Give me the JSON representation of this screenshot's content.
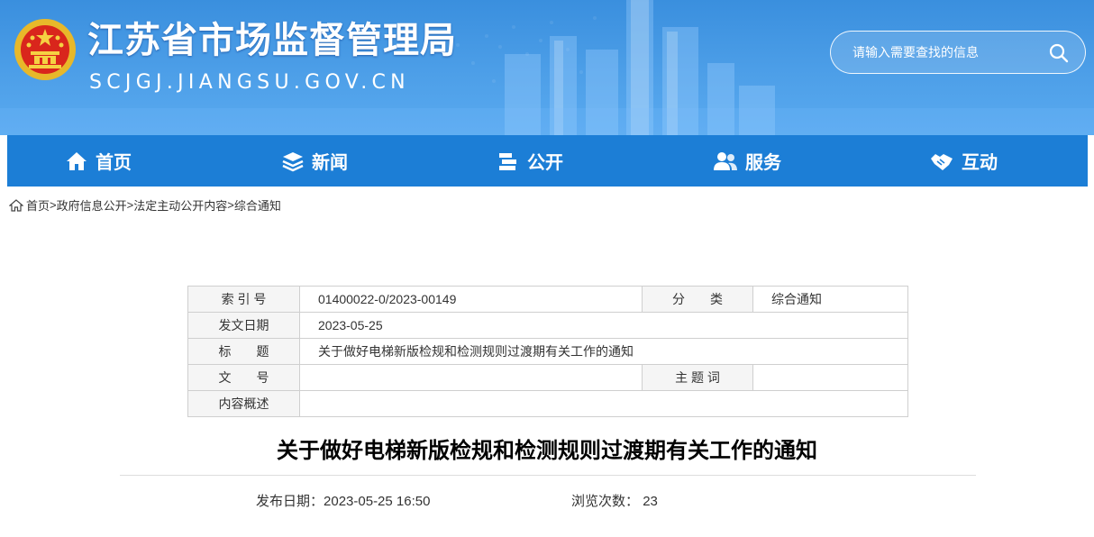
{
  "header": {
    "site_title": "江苏省市场监督管理局",
    "site_domain": "SCJGJ.JIANGSU.GOV.CN",
    "emblem_icon": "national-emblem-icon",
    "search_placeholder": "请输入需要查找的信息",
    "search_icon": "search-icon"
  },
  "nav": {
    "items": [
      {
        "label": "首页",
        "icon": "home-icon"
      },
      {
        "label": "新闻",
        "icon": "layers-icon"
      },
      {
        "label": "公开",
        "icon": "books-icon"
      },
      {
        "label": "服务",
        "icon": "users-icon"
      },
      {
        "label": "互动",
        "icon": "handshake-icon"
      }
    ]
  },
  "breadcrumb": {
    "items": [
      "首页",
      "政府信息公开",
      "法定主动公开内容",
      "综合通知"
    ],
    "separator": ">"
  },
  "meta": {
    "index_label": "索 引 号",
    "index_value": "01400022-0/2023-00149",
    "category_label": "分　　类",
    "category_value": "综合通知",
    "date_label": "发文日期",
    "date_value": "2023-05-25",
    "title_label": "标　　题",
    "title_value": "关于做好电梯新版检规和检测规则过渡期有关工作的通知",
    "docno_label": "文　　号",
    "docno_value": "",
    "keywords_label": "主 题 词",
    "keywords_value": "",
    "summary_label": "内容概述",
    "summary_value": ""
  },
  "article": {
    "title": "关于做好电梯新版检规和检测规则过渡期有关工作的通知",
    "publish_label": "发布日期：",
    "publish_value": "2023-05-25 16:50",
    "views_label": "浏览次数：",
    "views_value": "23"
  },
  "colors": {
    "header_blue": "#3a8fde",
    "nav_blue": "#1c7ed6",
    "table_border": "#cfcfcf",
    "label_bg": "#f5f5f5"
  }
}
